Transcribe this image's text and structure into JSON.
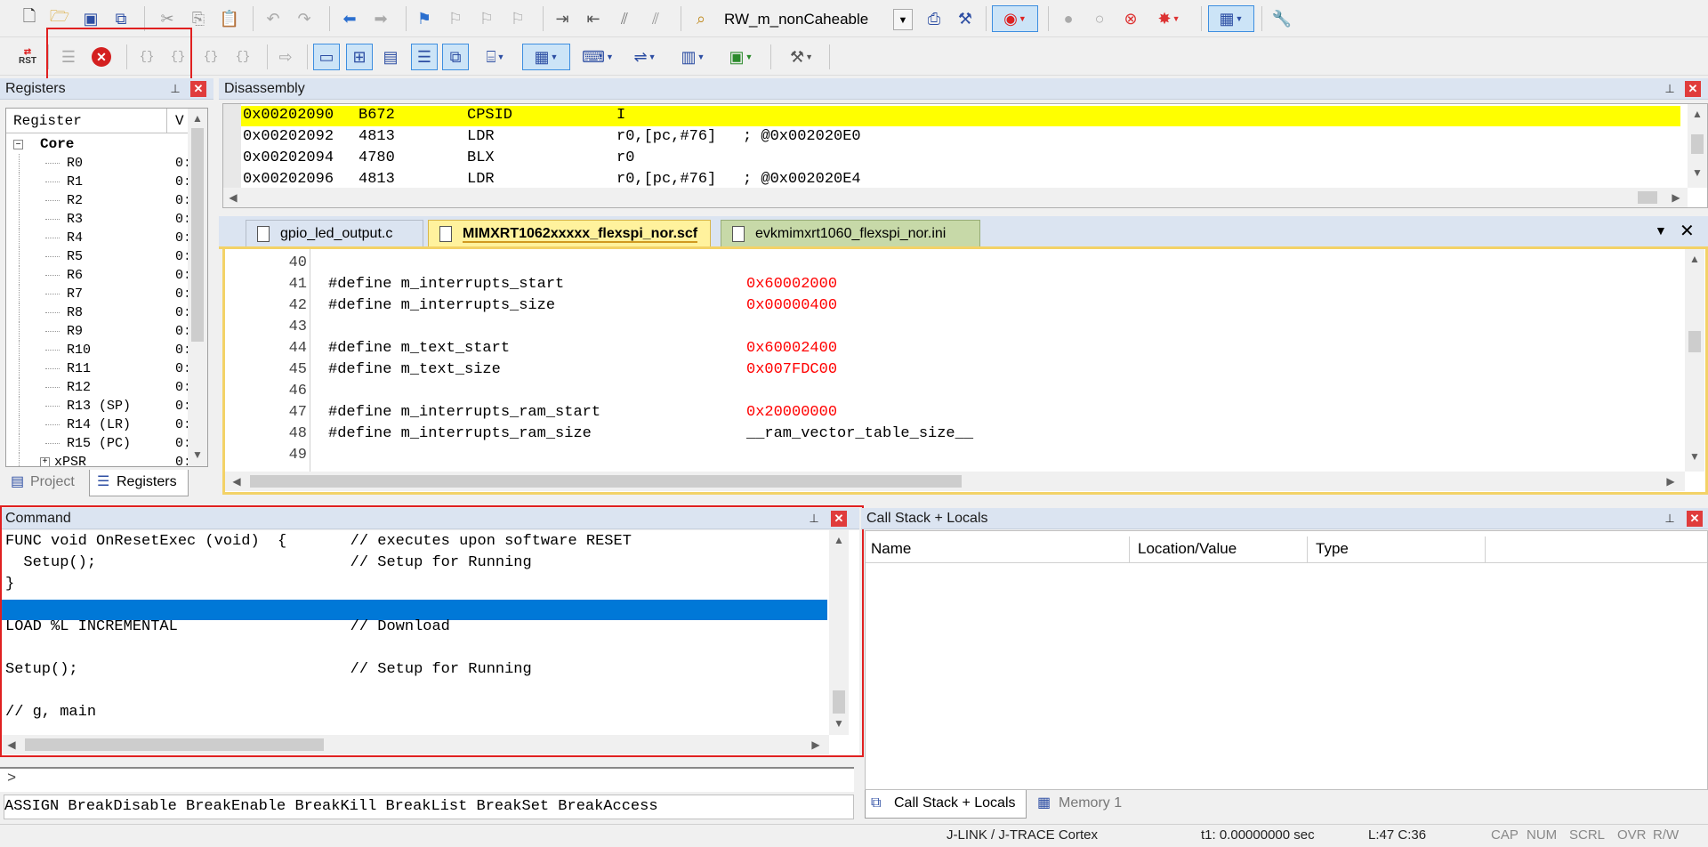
{
  "toolbar1": {
    "target_name": "RW_m_nonCaheable",
    "icons": [
      "new-file-icon",
      "open-file-icon",
      "save-icon",
      "save-all-icon",
      "cut-icon",
      "copy-icon",
      "paste-icon",
      "undo-icon",
      "redo-icon",
      "nav-back-icon",
      "nav-forward-icon",
      "bookmark-icon",
      "prev-bookmark-icon",
      "next-bookmark-icon",
      "clear-bookmarks-icon",
      "indent-icon",
      "unindent-icon",
      "comment-icon",
      "uncomment-icon",
      "find-in-files-icon"
    ]
  },
  "toolbar2": {
    "reset_label": "RST"
  },
  "registers": {
    "title": "Registers",
    "col_register": "Register",
    "col_value": "V",
    "core_label": "Core",
    "rows": [
      "R0",
      "R1",
      "R2",
      "R3",
      "R4",
      "R5",
      "R6",
      "R7",
      "R8",
      "R9",
      "R10",
      "R11",
      "R12",
      "R13 (SP)",
      "R14 (LR)",
      "R15 (PC)",
      "xPSR"
    ],
    "value_prefix": "0:",
    "tab_project": "Project",
    "tab_registers": "Registers"
  },
  "disassembly": {
    "title": "Disassembly",
    "rows": [
      {
        "addr": "0x00202090",
        "hex": "B672",
        "op": "CPSID",
        "args": "I",
        "comment": ""
      },
      {
        "addr": "0x00202092",
        "hex": "4813",
        "op": "LDR",
        "args": "r0,[pc,#76]",
        "comment": "; @0x002020E0"
      },
      {
        "addr": "0x00202094",
        "hex": "4780",
        "op": "BLX",
        "args": "r0",
        "comment": ""
      },
      {
        "addr": "0x00202096",
        "hex": "4813",
        "op": "LDR",
        "args": "r0,[pc,#76]",
        "comment": "; @0x002020E4"
      }
    ]
  },
  "editor": {
    "tabs": [
      {
        "label": "gpio_led_output.c"
      },
      {
        "label": "MIMXRT1062xxxxx_flexspi_nor.scf"
      },
      {
        "label": "evkmimxrt1060_flexspi_nor.ini"
      }
    ],
    "lines": [
      {
        "num": "40",
        "code": "",
        "value": ""
      },
      {
        "num": "41",
        "code": "#define m_interrupts_start",
        "value": "0x60002000"
      },
      {
        "num": "42",
        "code": "#define m_interrupts_size",
        "value": "0x00000400"
      },
      {
        "num": "43",
        "code": "",
        "value": ""
      },
      {
        "num": "44",
        "code": "#define m_text_start",
        "value": "0x60002400"
      },
      {
        "num": "45",
        "code": "#define m_text_size",
        "value": "0x007FDC00"
      },
      {
        "num": "46",
        "code": "",
        "value": ""
      },
      {
        "num": "47",
        "code": "#define m_interrupts_ram_start",
        "value": "0x20000000"
      },
      {
        "num": "48",
        "code": "#define m_interrupts_ram_size",
        "value": "__ram_vector_table_size__"
      },
      {
        "num": "49",
        "code": "",
        "value": ""
      }
    ]
  },
  "command": {
    "title": "Command",
    "lines": [
      "FUNC void OnResetExec (void)  {       // executes upon software RESET",
      "  Setup();                            // Setup for Running",
      "}",
      "",
      "LOAD %L INCREMENTAL                   // Download",
      "",
      "Setup();                              // Setup for Running",
      "",
      "// g, main"
    ],
    "prompt": ">",
    "hint": "ASSIGN BreakDisable BreakEnable BreakKill BreakList BreakSet BreakAccess"
  },
  "callstack": {
    "title": "Call Stack + Locals",
    "col_name": "Name",
    "col_location": "Location/Value",
    "col_type": "Type",
    "tab_callstack": "Call Stack + Locals",
    "tab_memory": "Memory 1"
  },
  "status": {
    "debugger": "J-LINK / J-TRACE Cortex",
    "time": "t1: 0.00000000 sec",
    "cursor": "L:47 C:36",
    "cap": "CAP",
    "num": "NUM",
    "scrl": "SCRL",
    "ovr": "OVR",
    "rw": "R/W"
  },
  "colors": {
    "highlight_yellow": "#ffff00",
    "selection_blue": "#0078d7",
    "annotation_red": "#e02020",
    "value_red": "#ff0000",
    "pane_title": "#dbe4f1",
    "active_tab": "#fff29d"
  }
}
